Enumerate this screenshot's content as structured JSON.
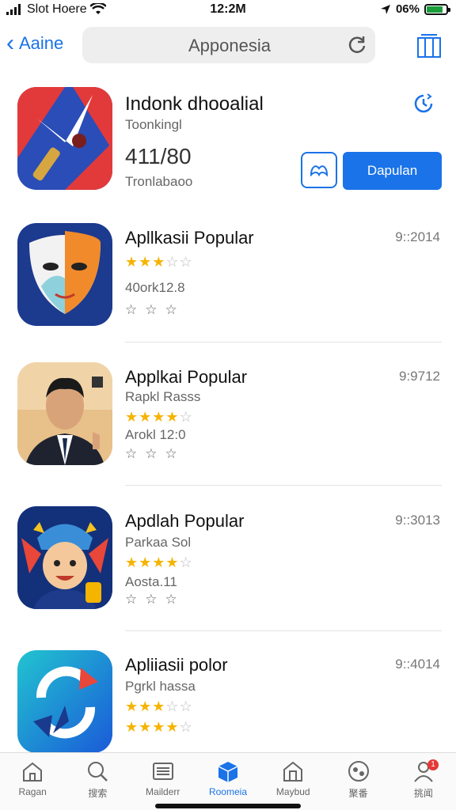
{
  "status": {
    "carrier": "Slot Hoere",
    "time": "12:2M",
    "battery": "06%",
    "battery_level": 0.85
  },
  "nav": {
    "back_label": "Aaine",
    "search_value": "Apponesia"
  },
  "featured": {
    "title": "Indonk dhooalial",
    "subtitle": "Toonkingl",
    "number": "411/80",
    "info": "Tronlabaoo",
    "cta_label": "Dapulan"
  },
  "apps": [
    {
      "title": "Apllkasii Popular",
      "time": "9::2014",
      "line1": "",
      "line2": "40ork12.8",
      "rating": 3,
      "rating_max": 5
    },
    {
      "title": "Applkai Popular",
      "time": "9:9712",
      "line1": "Rapkl Rasss",
      "line2": "Arokl 12:0",
      "rating": 4,
      "rating_max": 5
    },
    {
      "title": "Apdlah Popular",
      "time": "9::3013",
      "line1": "Parkaa Sol",
      "line2": "Aosta.11",
      "rating": 4,
      "rating_max": 5
    },
    {
      "title": "Apliiasii polor",
      "time": "9::4014",
      "line1": "Pgrkl hassa",
      "line2": "",
      "rating": 3,
      "rating_max": 5
    }
  ],
  "tabs": [
    {
      "label": "Ragan",
      "icon": "home-icon"
    },
    {
      "label": "搜索",
      "icon": "search-icon"
    },
    {
      "label": "Mailderr",
      "icon": "list-icon"
    },
    {
      "label": "Roomeia",
      "icon": "box-icon",
      "active": true
    },
    {
      "label": "Maybud",
      "icon": "store-icon"
    },
    {
      "label": "聚番",
      "icon": "game-icon"
    },
    {
      "label": "挑闻",
      "icon": "profile-icon",
      "badge": "1"
    }
  ],
  "colors": {
    "accent": "#1a73e8",
    "star": "#f5b400"
  }
}
